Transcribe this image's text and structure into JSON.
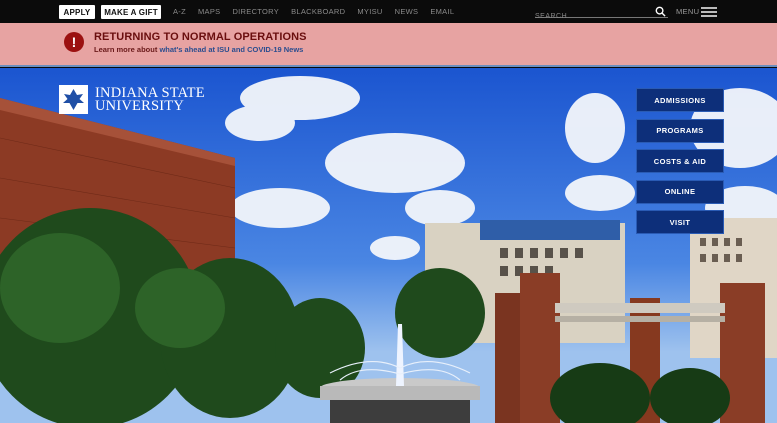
{
  "topbar": {
    "apply_label": "APPLY",
    "gift_label": "MAKE A GIFT",
    "nav": [
      "A-Z",
      "MAPS",
      "DIRECTORY",
      "BLACKBOARD",
      "MYISU",
      "NEWS",
      "EMAIL"
    ],
    "search_placeholder": "SEARCH",
    "menu_label": "MENU"
  },
  "alert": {
    "title": "RETURNING TO NORMAL OPERATIONS",
    "sub_prefix": "Learn more about ",
    "sub_link": "what's ahead at ISU and COVID-19 News"
  },
  "logo": {
    "line1": "INDIANA STATE",
    "line2": "UNIVERSITY"
  },
  "side_nav": [
    "ADMISSIONS",
    "PROGRAMS",
    "COSTS & AID",
    "ONLINE",
    "VISIT"
  ]
}
